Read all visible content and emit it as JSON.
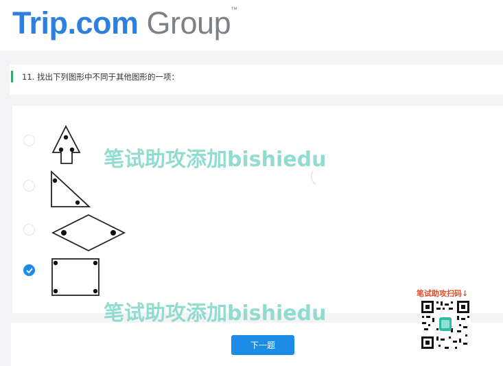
{
  "header": {
    "logo_trip": "Trip.com",
    "logo_group": "Group",
    "logo_tm": "™"
  },
  "question": {
    "text": "11. 找出下列图形中不同于其他图形的一项："
  },
  "options": [
    {
      "shape": "arrow",
      "selected": false
    },
    {
      "shape": "right-triangle",
      "selected": false
    },
    {
      "shape": "rhombus",
      "selected": false
    },
    {
      "shape": "rectangle",
      "selected": true
    }
  ],
  "footer": {
    "next_label": "下一题"
  },
  "watermark": {
    "text": "笔试助攻添加bishiedu"
  },
  "qr": {
    "label": "笔试助攻扫码↓"
  },
  "colors": {
    "accent": "#1c8ce6",
    "green_bar": "#2eaa6a",
    "watermark": "#7fd7c7",
    "qr_label": "#e04e2a"
  }
}
